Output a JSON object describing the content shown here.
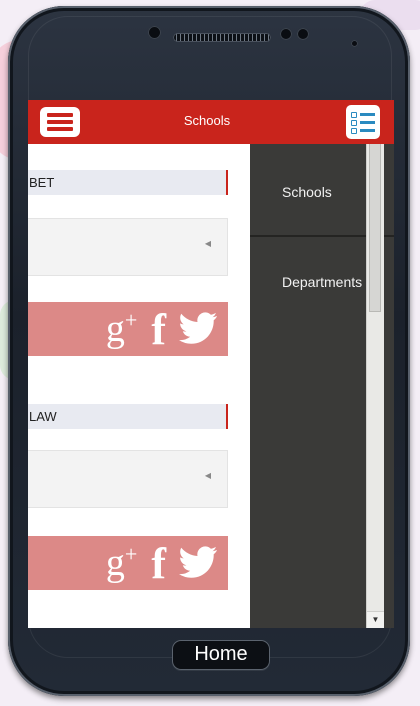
{
  "app": {
    "title": "Schools",
    "theme_color": "#c9241c",
    "menu_icon": "hamburger-menu-icon",
    "list_icon": "list-view-icon"
  },
  "cards": [
    {
      "title": "BET",
      "social": [
        "google-plus-icon",
        "facebook-icon",
        "twitter-icon"
      ]
    },
    {
      "title": "LAW",
      "social": [
        "google-plus-icon",
        "facebook-icon",
        "twitter-icon"
      ]
    }
  ],
  "drawer": {
    "background": "#3a3a38",
    "items": [
      {
        "label": "Schools"
      },
      {
        "label": "Departments"
      }
    ]
  },
  "device": {
    "home_label": "Home"
  }
}
